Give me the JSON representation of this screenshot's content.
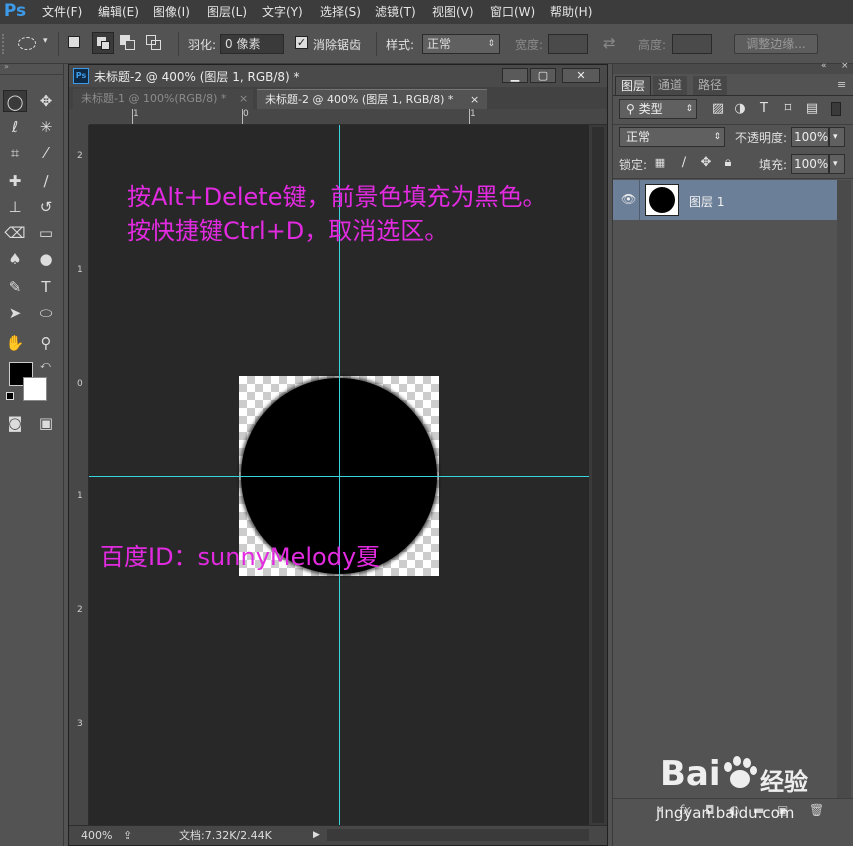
{
  "app": {
    "logo": "Ps"
  },
  "menu": [
    "文件(F)",
    "编辑(E)",
    "图像(I)",
    "图层(L)",
    "文字(Y)",
    "选择(S)",
    "滤镜(T)",
    "视图(V)",
    "窗口(W)",
    "帮助(H)"
  ],
  "options": {
    "feather_label": "羽化:",
    "feather_value": "0 像素",
    "antialias_label": "消除锯齿",
    "style_label": "样式:",
    "style_value": "正常",
    "width_label": "宽度:",
    "height_label": "高度:",
    "refine_edge_label": "调整边缘..."
  },
  "document": {
    "window_title": "未标题-2 @ 400% (图层 1, RGB/8) *",
    "tabs": [
      {
        "label": "未标题-1 @ 100%(RGB/8) *",
        "active": false
      },
      {
        "label": "未标题-2 @ 400% (图层 1, RGB/8) *",
        "active": true
      }
    ],
    "ruler_h": [
      "1",
      "0",
      "1"
    ],
    "ruler_v": [
      "2",
      "1",
      "0",
      "1",
      "2",
      "3"
    ],
    "annotation_lines": [
      "按Alt+Delete键，前景色填充为黑色。",
      "按快捷键Ctrl+D，取消选区。"
    ],
    "watermark_id": "百度ID：sunnyMelody夏",
    "zoom": "400%",
    "doc_info": "文档:7.32K/2.44K"
  },
  "layers_panel": {
    "tabs": [
      "图层",
      "通道",
      "路径"
    ],
    "filter_kind": "类型",
    "blend_mode": "正常",
    "opacity_label": "不透明度:",
    "opacity_value": "100%",
    "lock_label": "锁定:",
    "fill_label": "填充:",
    "fill_value": "100%",
    "layers": [
      {
        "name": "图层 1"
      }
    ]
  },
  "watermark": {
    "brand": "Bai",
    "brand2": "经验",
    "url": "jingyan.baidu.com"
  },
  "colors": {
    "guide": "#3ad3e0",
    "annotation": "#e22be0",
    "selected_layer": "#6c7f99"
  }
}
